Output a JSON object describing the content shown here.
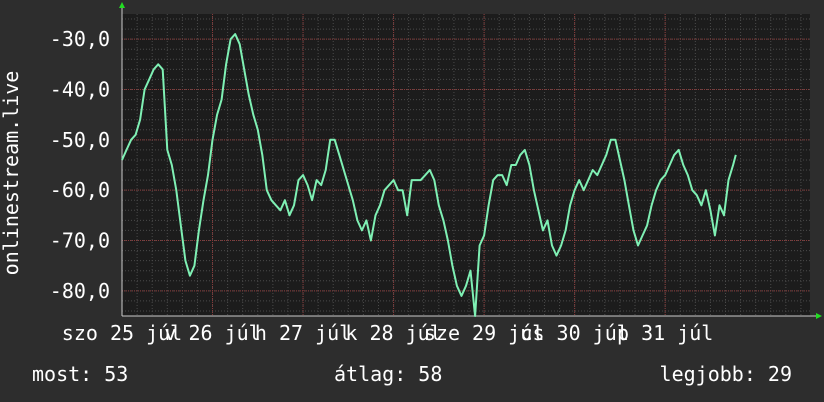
{
  "colors": {
    "background": "#2d2d2d",
    "plot_background": "#1c1c1c",
    "major_grid": "#8a3a3a",
    "minor_grid": "#4a4a4a",
    "line": "#7ff0b4",
    "axis_arrow": "#22dd22",
    "text": "#ffffff"
  },
  "stats": {
    "now_label": "most:",
    "now_value": "53",
    "avg_label": "átlag:",
    "avg_value": "58",
    "best_label": "legjobb:",
    "best_value": "29"
  },
  "chart_data": {
    "type": "line",
    "title": "",
    "xlabel": "",
    "ylabel": "onlinestream.live",
    "ylim": [
      -85,
      -25
    ],
    "y_ticks": [
      "-30,0",
      "-40,0",
      "-50,0",
      "-60,0",
      "-70,0",
      "-80,0"
    ],
    "y_tick_values": [
      -30,
      -40,
      -50,
      -60,
      -70,
      -80
    ],
    "x_ticks": [
      "szo 25 júl",
      "v 26 júl",
      "h 27 júl",
      "k 28 júl",
      "sze 29 júl",
      "cs 30 júl",
      "p 31 júl"
    ],
    "x_tick_values": [
      0,
      1,
      2,
      3,
      4,
      5,
      6
    ],
    "xlim": [
      0,
      7.6
    ],
    "grid": true,
    "series": [
      {
        "values": [
          [
            0.0,
            -54
          ],
          [
            0.05,
            -52
          ],
          [
            0.1,
            -50
          ],
          [
            0.15,
            -49
          ],
          [
            0.2,
            -46
          ],
          [
            0.25,
            -40
          ],
          [
            0.3,
            -38
          ],
          [
            0.35,
            -36
          ],
          [
            0.4,
            -35
          ],
          [
            0.45,
            -36
          ],
          [
            0.5,
            -52
          ],
          [
            0.55,
            -55
          ],
          [
            0.6,
            -60
          ],
          [
            0.65,
            -67
          ],
          [
            0.7,
            -74
          ],
          [
            0.75,
            -77
          ],
          [
            0.8,
            -75
          ],
          [
            0.85,
            -68
          ],
          [
            0.9,
            -62
          ],
          [
            0.95,
            -57
          ],
          [
            1.0,
            -50
          ],
          [
            1.05,
            -45
          ],
          [
            1.1,
            -42
          ],
          [
            1.15,
            -35
          ],
          [
            1.2,
            -30
          ],
          [
            1.25,
            -29
          ],
          [
            1.3,
            -31
          ],
          [
            1.35,
            -36
          ],
          [
            1.4,
            -41
          ],
          [
            1.45,
            -45
          ],
          [
            1.5,
            -48
          ],
          [
            1.55,
            -53
          ],
          [
            1.6,
            -60
          ],
          [
            1.65,
            -62
          ],
          [
            1.7,
            -63
          ],
          [
            1.75,
            -64
          ],
          [
            1.8,
            -62
          ],
          [
            1.85,
            -65
          ],
          [
            1.9,
            -63
          ],
          [
            1.95,
            -58
          ],
          [
            2.0,
            -57
          ],
          [
            2.05,
            -59
          ],
          [
            2.1,
            -62
          ],
          [
            2.15,
            -58
          ],
          [
            2.2,
            -59
          ],
          [
            2.25,
            -56
          ],
          [
            2.3,
            -50
          ],
          [
            2.35,
            -50
          ],
          [
            2.4,
            -53
          ],
          [
            2.45,
            -56
          ],
          [
            2.5,
            -59
          ],
          [
            2.55,
            -62
          ],
          [
            2.6,
            -66
          ],
          [
            2.65,
            -68
          ],
          [
            2.7,
            -66
          ],
          [
            2.75,
            -70
          ],
          [
            2.8,
            -65
          ],
          [
            2.85,
            -63
          ],
          [
            2.9,
            -60
          ],
          [
            2.95,
            -59
          ],
          [
            3.0,
            -58
          ],
          [
            3.05,
            -60
          ],
          [
            3.1,
            -60
          ],
          [
            3.15,
            -65
          ],
          [
            3.2,
            -58
          ],
          [
            3.25,
            -58
          ],
          [
            3.3,
            -58
          ],
          [
            3.35,
            -57
          ],
          [
            3.4,
            -56
          ],
          [
            3.45,
            -58
          ],
          [
            3.5,
            -63
          ],
          [
            3.55,
            -66
          ],
          [
            3.6,
            -70
          ],
          [
            3.65,
            -75
          ],
          [
            3.7,
            -79
          ],
          [
            3.75,
            -81
          ],
          [
            3.8,
            -79
          ],
          [
            3.85,
            -76
          ],
          [
            3.9,
            -85
          ],
          [
            3.95,
            -71
          ],
          [
            4.0,
            -69
          ],
          [
            4.05,
            -63
          ],
          [
            4.1,
            -58
          ],
          [
            4.15,
            -57
          ],
          [
            4.2,
            -57
          ],
          [
            4.25,
            -59
          ],
          [
            4.3,
            -55
          ],
          [
            4.35,
            -55
          ],
          [
            4.4,
            -53
          ],
          [
            4.45,
            -52
          ],
          [
            4.5,
            -55
          ],
          [
            4.55,
            -60
          ],
          [
            4.6,
            -64
          ],
          [
            4.65,
            -68
          ],
          [
            4.7,
            -66
          ],
          [
            4.75,
            -71
          ],
          [
            4.8,
            -73
          ],
          [
            4.85,
            -71
          ],
          [
            4.9,
            -68
          ],
          [
            4.95,
            -63
          ],
          [
            5.0,
            -60
          ],
          [
            5.05,
            -58
          ],
          [
            5.1,
            -60
          ],
          [
            5.15,
            -58
          ],
          [
            5.2,
            -56
          ],
          [
            5.25,
            -57
          ],
          [
            5.3,
            -55
          ],
          [
            5.35,
            -53
          ],
          [
            5.4,
            -50
          ],
          [
            5.45,
            -50
          ],
          [
            5.5,
            -54
          ],
          [
            5.55,
            -58
          ],
          [
            5.6,
            -63
          ],
          [
            5.65,
            -68
          ],
          [
            5.7,
            -71
          ],
          [
            5.75,
            -69
          ],
          [
            5.8,
            -67
          ],
          [
            5.85,
            -63
          ],
          [
            5.9,
            -60
          ],
          [
            5.95,
            -58
          ],
          [
            6.0,
            -57
          ],
          [
            6.05,
            -55
          ],
          [
            6.1,
            -53
          ],
          [
            6.15,
            -52
          ],
          [
            6.2,
            -55
          ],
          [
            6.25,
            -57
          ],
          [
            6.3,
            -60
          ],
          [
            6.35,
            -61
          ],
          [
            6.4,
            -63
          ],
          [
            6.45,
            -60
          ],
          [
            6.5,
            -64
          ],
          [
            6.55,
            -69
          ],
          [
            6.6,
            -63
          ],
          [
            6.65,
            -65
          ],
          [
            6.7,
            -58
          ],
          [
            6.75,
            -55
          ],
          [
            6.78,
            -53
          ]
        ]
      }
    ]
  }
}
